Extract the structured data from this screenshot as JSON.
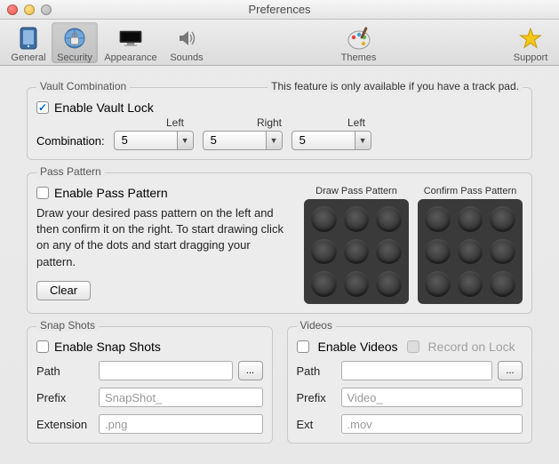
{
  "window": {
    "title": "Preferences"
  },
  "toolbar": {
    "general": "General",
    "security": "Security",
    "appearance": "Appearance",
    "sounds": "Sounds",
    "themes": "Themes",
    "support": "Support"
  },
  "vault": {
    "legend": "Vault Combination",
    "note": "This feature is only available if you have a track pad.",
    "enable_label": "Enable Vault Lock",
    "enable_checked": true,
    "combination_label": "Combination:",
    "dir1_label": "Left",
    "dir2_label": "Right",
    "dir3_label": "Left",
    "val1": "5",
    "val2": "5",
    "val3": "5"
  },
  "pattern": {
    "legend": "Pass Pattern",
    "enable_label": "Enable Pass Pattern",
    "instructions": "Draw your desired pass pattern on the left and then confirm it on the right. To start drawing click on any of the dots and start dragging your pattern.",
    "clear_label": "Clear",
    "draw_title": "Draw Pass Pattern",
    "confirm_title": "Confirm Pass Pattern"
  },
  "snap": {
    "legend": "Snap Shots",
    "enable_label": "Enable Snap Shots",
    "path_label": "Path",
    "path_value": "",
    "browse_label": "...",
    "prefix_label": "Prefix",
    "prefix_value": "SnapShot_",
    "ext_label": "Extension",
    "ext_value": ".png"
  },
  "videos": {
    "legend": "Videos",
    "enable_label": "Enable Videos",
    "record_label": "Record on Lock",
    "path_label": "Path",
    "path_value": "",
    "browse_label": "...",
    "prefix_label": "Prefix",
    "prefix_value": "Video_",
    "ext_label": "Ext",
    "ext_value": ".mov"
  }
}
